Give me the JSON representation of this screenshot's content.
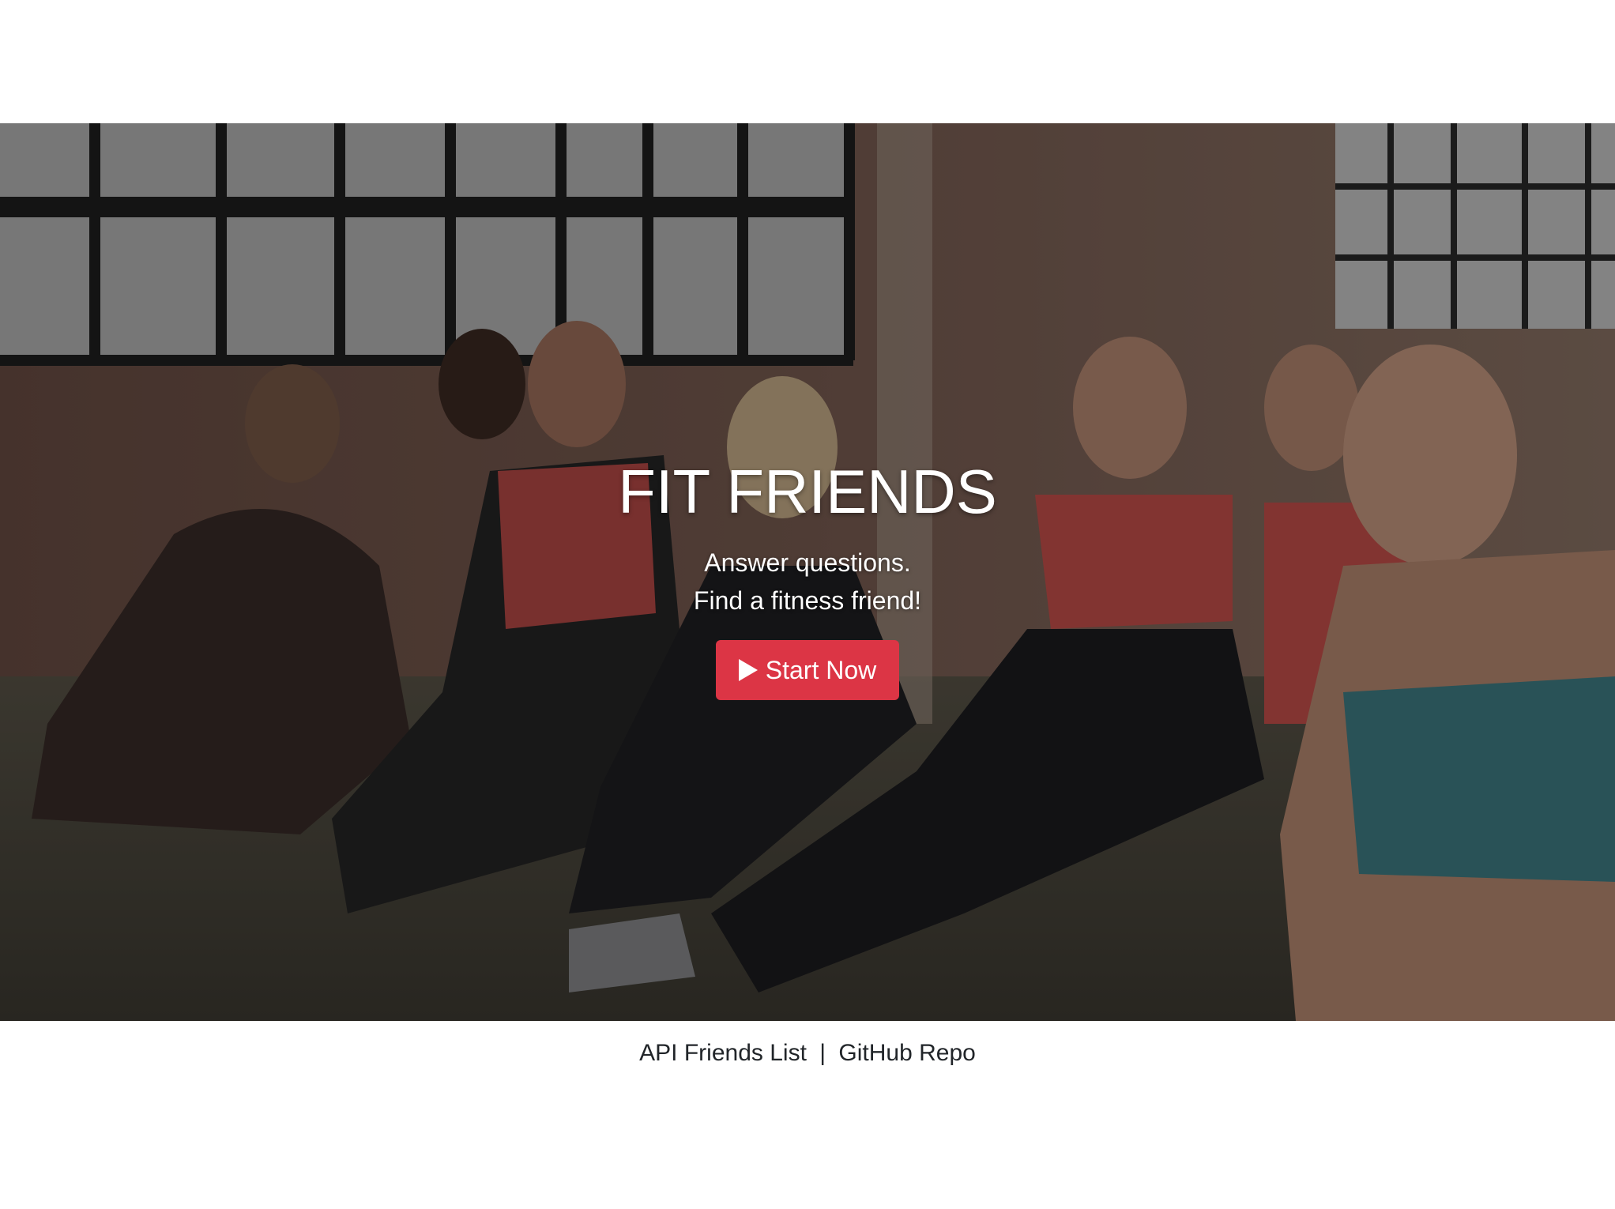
{
  "hero": {
    "title": "FIT FRIENDS",
    "subtitle_line1": "Answer questions.",
    "subtitle_line2": "Find a fitness friend!",
    "button_label": "Start Now",
    "button_icon": "play-icon",
    "button_color": "#dc3545"
  },
  "footer": {
    "link1": "API Friends List",
    "separator": "|",
    "link2": "GitHub Repo"
  }
}
